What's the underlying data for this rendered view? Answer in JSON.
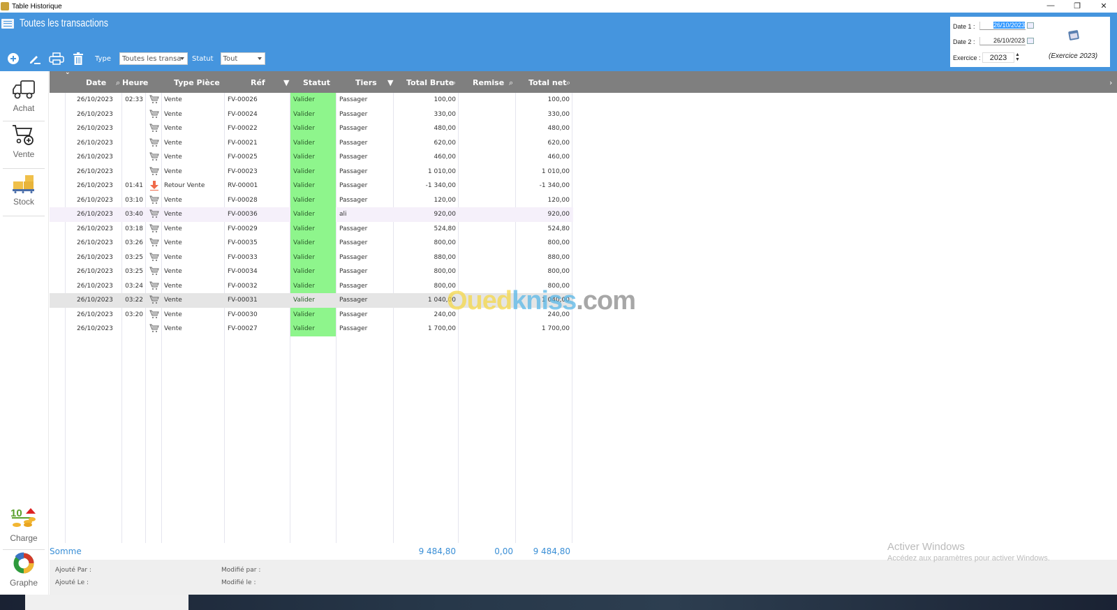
{
  "window": {
    "title": "Table Historique",
    "controls": [
      "minimize",
      "restore",
      "close"
    ]
  },
  "header": {
    "page_title": "Toutes les transactions",
    "toolbar": {
      "buttons": [
        {
          "name": "add",
          "icon": "plus-circle-icon"
        },
        {
          "name": "edit",
          "icon": "pencil-icon"
        },
        {
          "name": "print",
          "icon": "printer-icon"
        },
        {
          "name": "delete",
          "icon": "trash-icon"
        }
      ],
      "type_label": "Type",
      "type_value": "Toutes les transa",
      "statut_label": "Statut",
      "statut_value": "Tout"
    },
    "dates": {
      "date1_label": "Date 1 :",
      "date1_value": "26/10/2023",
      "date2_label": "Date 2 :",
      "date2_value": "26/10/2023",
      "exercice_label": "Exercice :",
      "exercice_value": "2023",
      "exercice_note": "(Exercice 2023)"
    }
  },
  "sidebar": {
    "items": [
      {
        "label": "Achat",
        "icon": "truck-icon"
      },
      {
        "label": "Vente",
        "icon": "cart-plus-icon"
      },
      {
        "label": "Stock",
        "icon": "boxes-pallet-icon"
      },
      {
        "label": "Charge",
        "icon": "coins-icon"
      },
      {
        "label": "Graphe",
        "icon": "donut-chart-icon"
      }
    ]
  },
  "table": {
    "columns": [
      "Date",
      "Heure",
      "Type Pièce",
      "Réf",
      "Statut",
      "Tiers",
      "Total Brute",
      "Remise",
      "Total net"
    ],
    "rows": [
      {
        "date": "26/10/2023",
        "heure": "02:33",
        "icon": "cart",
        "type": "Vente",
        "ref": "FV-00026",
        "statut": "Valider",
        "tiers": "Passager",
        "brute": "100,00",
        "remise": "",
        "net": "100,00"
      },
      {
        "date": "26/10/2023",
        "heure": "",
        "icon": "cart",
        "type": "Vente",
        "ref": "FV-00024",
        "statut": "Valider",
        "tiers": "Passager",
        "brute": "330,00",
        "remise": "",
        "net": "330,00"
      },
      {
        "date": "26/10/2023",
        "heure": "",
        "icon": "cart",
        "type": "Vente",
        "ref": "FV-00022",
        "statut": "Valider",
        "tiers": "Passager",
        "brute": "480,00",
        "remise": "",
        "net": "480,00"
      },
      {
        "date": "26/10/2023",
        "heure": "",
        "icon": "cart",
        "type": "Vente",
        "ref": "FV-00021",
        "statut": "Valider",
        "tiers": "Passager",
        "brute": "620,00",
        "remise": "",
        "net": "620,00"
      },
      {
        "date": "26/10/2023",
        "heure": "",
        "icon": "cart",
        "type": "Vente",
        "ref": "FV-00025",
        "statut": "Valider",
        "tiers": "Passager",
        "brute": "460,00",
        "remise": "",
        "net": "460,00"
      },
      {
        "date": "26/10/2023",
        "heure": "",
        "icon": "cart",
        "type": "Vente",
        "ref": "FV-00023",
        "statut": "Valider",
        "tiers": "Passager",
        "brute": "1 010,00",
        "remise": "",
        "net": "1 010,00"
      },
      {
        "date": "26/10/2023",
        "heure": "01:41",
        "icon": "return",
        "type": "Retour Vente",
        "ref": "RV-00001",
        "statut": "Valider",
        "tiers": "Passager",
        "brute": "-1 340,00",
        "remise": "",
        "net": "-1 340,00"
      },
      {
        "date": "26/10/2023",
        "heure": "03:10",
        "icon": "cart",
        "type": "Vente",
        "ref": "FV-00028",
        "statut": "Valider",
        "tiers": "Passager",
        "brute": "120,00",
        "remise": "",
        "net": "120,00"
      },
      {
        "date": "26/10/2023",
        "heure": "03:40",
        "icon": "cart",
        "type": "Vente",
        "ref": "FV-00036",
        "statut": "Valider",
        "tiers": "ali",
        "brute": "920,00",
        "remise": "",
        "net": "920,00"
      },
      {
        "date": "26/10/2023",
        "heure": "03:18",
        "icon": "cart",
        "type": "Vente",
        "ref": "FV-00029",
        "statut": "Valider",
        "tiers": "Passager",
        "brute": "524,80",
        "remise": "",
        "net": "524,80"
      },
      {
        "date": "26/10/2023",
        "heure": "03:26",
        "icon": "cart",
        "type": "Vente",
        "ref": "FV-00035",
        "statut": "Valider",
        "tiers": "Passager",
        "brute": "800,00",
        "remise": "",
        "net": "800,00"
      },
      {
        "date": "26/10/2023",
        "heure": "03:25",
        "icon": "cart",
        "type": "Vente",
        "ref": "FV-00033",
        "statut": "Valider",
        "tiers": "Passager",
        "brute": "880,00",
        "remise": "",
        "net": "880,00"
      },
      {
        "date": "26/10/2023",
        "heure": "03:25",
        "icon": "cart",
        "type": "Vente",
        "ref": "FV-00034",
        "statut": "Valider",
        "tiers": "Passager",
        "brute": "800,00",
        "remise": "",
        "net": "800,00"
      },
      {
        "date": "26/10/2023",
        "heure": "03:24",
        "icon": "cart",
        "type": "Vente",
        "ref": "FV-00032",
        "statut": "Valider",
        "tiers": "Passager",
        "brute": "800,00",
        "remise": "",
        "net": "800,00"
      },
      {
        "date": "26/10/2023",
        "heure": "03:22",
        "icon": "cart",
        "type": "Vente",
        "ref": "FV-00031",
        "statut": "Valider",
        "tiers": "Passager",
        "brute": "1 040,00",
        "remise": "",
        "net": "1 040,00",
        "selected": true
      },
      {
        "date": "26/10/2023",
        "heure": "03:20",
        "icon": "cart",
        "type": "Vente",
        "ref": "FV-00030",
        "statut": "Valider",
        "tiers": "Passager",
        "brute": "240,00",
        "remise": "",
        "net": "240,00"
      },
      {
        "date": "26/10/2023",
        "heure": "",
        "icon": "cart",
        "type": "Vente",
        "ref": "FV-00027",
        "statut": "Valider",
        "tiers": "Passager",
        "brute": "1 700,00",
        "remise": "",
        "net": "1 700,00"
      }
    ],
    "status_color": "#8ef58c"
  },
  "summary": {
    "label": "Somme",
    "total_brute": "9 484,80",
    "remise": "0,00",
    "total_net": "9 484,80"
  },
  "footer": {
    "ajoute_par": "Ajouté Par :",
    "ajoute_le": "Ajouté Le :",
    "modifie_par": "Modifié par :",
    "modifie_le": "Modifié le :"
  },
  "watermark": {
    "title": "Activer Windows",
    "subtitle": "Accédez aux paramètres pour activer Windows.",
    "ouedkniss_a": "Oued",
    "ouedkniss_b": "kniss",
    "ouedkniss_c": ".com"
  }
}
